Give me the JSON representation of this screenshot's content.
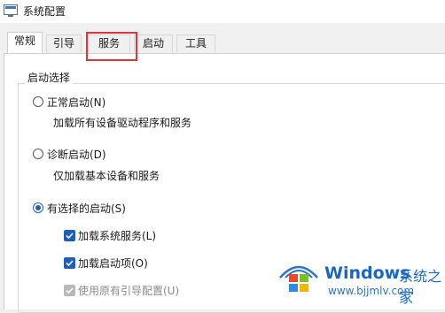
{
  "window": {
    "title": "系统配置",
    "icon": "msconfig-icon"
  },
  "tabs": [
    {
      "label": "常规",
      "active": true
    },
    {
      "label": "引导",
      "active": false
    },
    {
      "label": "服务",
      "active": false,
      "highlighted": true
    },
    {
      "label": "启动",
      "active": false
    },
    {
      "label": "工具",
      "active": false
    }
  ],
  "startup_selection": {
    "title": "启动选择",
    "options": [
      {
        "label": "正常启动(N)",
        "description": "加载所有设备驱动程序和服务",
        "checked": false
      },
      {
        "label": "诊断启动(D)",
        "description": "仅加载基本设备和服务",
        "checked": false
      },
      {
        "label": "有选择的启动(S)",
        "checked": true
      }
    ],
    "selective": [
      {
        "label": "加载系统服务(L)",
        "checked": true,
        "enabled": true
      },
      {
        "label": "加载启动项(O)",
        "checked": true,
        "enabled": true
      },
      {
        "label": "使用原有引导配置(U)",
        "checked": true,
        "enabled": false
      }
    ]
  },
  "watermark": {
    "brand": "Windows",
    "brand_suffix": "系统之家",
    "url": "www.bjjmlv.com"
  },
  "colors": {
    "accent": "#1f5fb8",
    "highlight": "#d9393a",
    "watermark": "#1a66c4"
  }
}
